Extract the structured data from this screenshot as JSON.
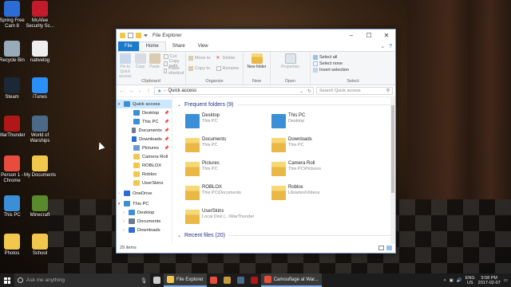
{
  "desktop_icons": [
    {
      "label": "Spring Free Cam 8",
      "icon": "spring-free-cam-icon",
      "color": "#2b6cd6"
    },
    {
      "label": "McAfee Security Sc...",
      "icon": "mcafee-icon",
      "color": "#c21b2b"
    },
    {
      "label": "Recycle Bin",
      "icon": "recycle-bin-icon",
      "color": "#9ab"
    },
    {
      "label": "nativelog",
      "icon": "text-file-icon",
      "color": "#eee"
    },
    {
      "label": "Steam",
      "icon": "steam-icon",
      "color": "#1b2838"
    },
    {
      "label": "iTunes",
      "icon": "itunes-icon",
      "color": "#2a8ff7"
    },
    {
      "label": "WarThunder",
      "icon": "warthunder-icon",
      "color": "#b01717"
    },
    {
      "label": "World of Warships",
      "icon": "world-of-warships-icon",
      "color": "#4b6a88"
    },
    {
      "label": "Person 1 - Chrome",
      "icon": "chrome-icon",
      "color": "#e74c3c"
    },
    {
      "label": "My Documents",
      "icon": "folder-icon",
      "color": "#f1c84b"
    },
    {
      "label": "This PC",
      "icon": "this-pc-icon",
      "color": "#3b8fd6"
    },
    {
      "label": "Minecraft",
      "icon": "minecraft-icon",
      "color": "#5a8a2b"
    },
    {
      "label": "Photos",
      "icon": "folder-icon",
      "color": "#f1c84b"
    },
    {
      "label": "School",
      "icon": "folder-icon",
      "color": "#f1c84b"
    }
  ],
  "window": {
    "title": "File Explorer",
    "tabs": [
      "File",
      "Home",
      "Share",
      "View"
    ],
    "active_tab": "Home",
    "ribbon": {
      "clipboard": {
        "name": "Clipboard",
        "pin": "Pin to Quick access",
        "copy": "Copy",
        "paste": "Paste",
        "cut": "Cut",
        "copy_path": "Copy path",
        "paste_shortcut": "Paste shortcut"
      },
      "organize": {
        "name": "Organize",
        "move_to": "Move to",
        "copy_to": "Copy to",
        "delete": "Delete",
        "rename": "Rename"
      },
      "new": {
        "name": "New",
        "new_folder": "New folder"
      },
      "open": {
        "name": "Open",
        "properties": "Properties"
      },
      "select": {
        "name": "Select",
        "select_all": "Select all",
        "select_none": "Select none",
        "invert": "Invert selection"
      }
    },
    "address": "Quick access",
    "search_placeholder": "Search Quick access",
    "nav_pane": [
      {
        "label": "Quick access",
        "icon": "star-icon",
        "color": "#3b8fd6",
        "pinned": false,
        "selected": true,
        "arrow": "▾"
      },
      {
        "label": "Desktop",
        "icon": "desktop-icon",
        "color": "#3b8fd6",
        "pinned": true
      },
      {
        "label": "This PC",
        "icon": "this-pc-icon",
        "color": "#3b8fd6",
        "pinned": true
      },
      {
        "label": "Documents",
        "icon": "documents-icon",
        "color": "#6b7b8c",
        "pinned": true
      },
      {
        "label": "Downloads",
        "icon": "downloads-icon",
        "color": "#2b6cd6",
        "pinned": true
      },
      {
        "label": "Pictures",
        "icon": "pictures-icon",
        "color": "#6b9bd6",
        "pinned": true
      },
      {
        "label": "Camera Roll",
        "icon": "folder-icon",
        "color": "#f1c84b"
      },
      {
        "label": "ROBLOX",
        "icon": "folder-icon",
        "color": "#f1c84b"
      },
      {
        "label": "Roblox",
        "icon": "folder-icon",
        "color": "#f1c84b"
      },
      {
        "label": "UserSkins",
        "icon": "folder-icon",
        "color": "#f1c84b"
      },
      {
        "label": "OneDrive",
        "icon": "onedrive-icon",
        "color": "#2b6cd6",
        "arrow": "›"
      },
      {
        "label": "This PC",
        "icon": "this-pc-icon",
        "color": "#3b8fd6",
        "arrow": "▾"
      },
      {
        "label": "Desktop",
        "icon": "desktop-icon",
        "color": "#3b8fd6",
        "arrow": "›"
      },
      {
        "label": "Documents",
        "icon": "documents-icon",
        "color": "#6b7b8c",
        "arrow": "›"
      },
      {
        "label": "Downloads",
        "icon": "downloads-icon",
        "color": "#2b6cd6",
        "arrow": "›"
      }
    ],
    "frequent_header": "Frequent folders (9)",
    "recent_header": "Recent files (20)",
    "frequent": [
      {
        "name": "Desktop",
        "sub": "This PC",
        "icon": "desktop-folder-icon",
        "color": "#3b8fd6"
      },
      {
        "name": "This PC",
        "sub": "Desktop",
        "icon": "this-pc-icon",
        "color": "#3b8fd6"
      },
      {
        "name": "Documents",
        "sub": "This PC",
        "icon": "documents-folder-icon",
        "color": "#f1c84b"
      },
      {
        "name": "Downloads",
        "sub": "This PC",
        "icon": "downloads-folder-icon",
        "color": "#f1c84b"
      },
      {
        "name": "Pictures",
        "sub": "This PC",
        "icon": "pictures-folder-icon",
        "color": "#f1c84b"
      },
      {
        "name": "Camera Roll",
        "sub": "This PC\\Pictures",
        "icon": "folder-icon",
        "color": "#f1c84b"
      },
      {
        "name": "ROBLOX",
        "sub": "This PC\\Documents",
        "icon": "folder-icon",
        "color": "#f1c84b"
      },
      {
        "name": "Roblox",
        "sub": "Libraries\\Videos",
        "icon": "folder-icon",
        "color": "#f1c84b"
      },
      {
        "name": "UserSkins",
        "sub": "Local Disk (...\\WarThunder",
        "icon": "folder-icon",
        "color": "#f1c84b"
      }
    ],
    "status": "29 items"
  },
  "taskbar": {
    "search_placeholder": "Ask me anything",
    "items": [
      {
        "label": "",
        "icon": "task-view-icon",
        "color": "#ccc"
      },
      {
        "label": "File Explorer",
        "icon": "file-explorer-icon",
        "color": "#f1c84b",
        "active": true
      },
      {
        "label": "",
        "icon": "chrome-icon",
        "color": "#e74c3c"
      },
      {
        "label": "",
        "icon": "game-icon",
        "color": "#c59b3b"
      },
      {
        "label": "",
        "icon": "warships-icon",
        "color": "#4b6a88"
      },
      {
        "label": "",
        "icon": "warthunder-icon",
        "color": "#b01717"
      },
      {
        "label": "Camouflage at War...",
        "icon": "chrome-icon",
        "color": "#e74c3c",
        "active": true
      }
    ],
    "tray": {
      "language": "ENG",
      "region": "US",
      "time": "9:58 PM",
      "date": "2017-02-07"
    }
  }
}
